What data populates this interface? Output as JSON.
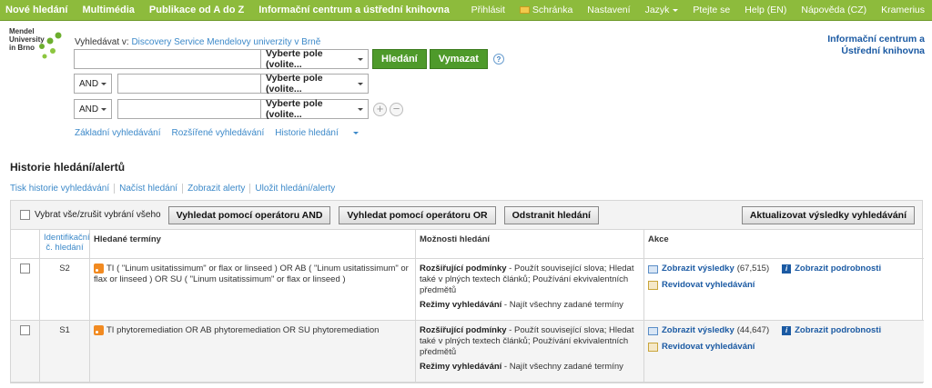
{
  "topnav": {
    "left": [
      "Nové hledání",
      "Multimédia",
      "Publikace od A do Z",
      "Informační centrum a ústřední knihovna"
    ],
    "right": {
      "login": "Přihlásit",
      "folder": "Schránka",
      "settings": "Nastavení",
      "language": "Jazyk",
      "ask": "Ptejte se",
      "help_en": "Help (EN)",
      "help_cz": "Nápověda (CZ)",
      "kramerius": "Kramerius"
    }
  },
  "logo": {
    "line1": "Mendel",
    "line2": "University",
    "line3": "in Brno"
  },
  "institution": {
    "line1": "Informační centrum a",
    "line2": "Ústřední knihovna"
  },
  "search": {
    "label_prefix": "Vyhledávat v:",
    "label_link": "Discovery Service Mendelovy univerzity v Brně",
    "field_select": "Vyberte pole (volite...",
    "search_button": "Hledání",
    "clear_button": "Vymazat",
    "help": "?",
    "bool_op": "AND",
    "links": {
      "basic": "Základní vyhledávání",
      "advanced": "Rozšířené vyhledávání",
      "history": "Historie hledání"
    }
  },
  "history": {
    "title": "Historie hledání/alertů",
    "actions": [
      "Tisk historie vyhledávání",
      "Načíst hledání",
      "Zobrazit alerty",
      "Uložit hledání/alerty"
    ],
    "toolbar": {
      "select_all": "Vybrat vše/zrušit vybrání všeho",
      "and_button": "Vyhledat pomocí operátoru AND",
      "or_button": "Vyhledat pomocí operátoru OR",
      "remove_button": "Odstranit hledání",
      "update_button": "Aktualizovat výsledky vyhledávání"
    },
    "headers": {
      "id_line1": "Identifikační",
      "id_line2": "č. hledání",
      "terms": "Hledané termíny",
      "options": "Možnosti hledání",
      "actions": "Akce"
    },
    "rows": [
      {
        "id": "S2",
        "terms": "TI ( \"Linum usitatissimum\" or flax or linseed ) OR AB ( \"Linum usitatissimum\" or flax or linseed ) OR SU ( \"Linum usitatissimum\" or flax or linseed )",
        "opt_label": "Rozšiřující podmínky",
        "opt_text": " - Použít související slova; Hledat také v plných textech článků; Používání ekvivalentních předmětů",
        "mode_label": "Režimy vyhledávání",
        "mode_text": " - Najít všechny zadané termíny",
        "show_results": "Zobrazit výsledky",
        "count": "(67,515)",
        "details": "Zobrazit podrobnosti",
        "revise": "Revidovat vyhledávání"
      },
      {
        "id": "S1",
        "terms": "TI phytoremediation OR AB phytoremediation OR SU phytoremediation",
        "opt_label": "Rozšiřující podmínky",
        "opt_text": " - Použít související slova; Hledat také v plných textech článků; Používání ekvivalentních předmětů",
        "mode_label": "Režimy vyhledávání",
        "mode_text": " - Najít všechny zadané termíny",
        "show_results": "Zobrazit výsledky",
        "count": "(44,647)",
        "details": "Zobrazit podrobnosti",
        "revise": "Revidovat vyhledávání"
      }
    ]
  }
}
